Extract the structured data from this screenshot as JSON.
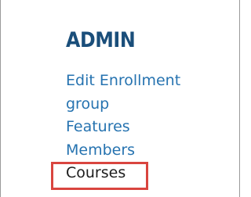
{
  "admin": {
    "title": "ADMIN",
    "items": [
      {
        "label": "Edit Enrollment"
      },
      {
        "label": "group"
      },
      {
        "label": "Features"
      },
      {
        "label": "Members"
      },
      {
        "label": "Courses"
      }
    ]
  },
  "colors": {
    "title": "#1a4e7a",
    "link": "#2673b0",
    "current_text": "#1c1c1c",
    "highlight_border": "#d9453f"
  }
}
